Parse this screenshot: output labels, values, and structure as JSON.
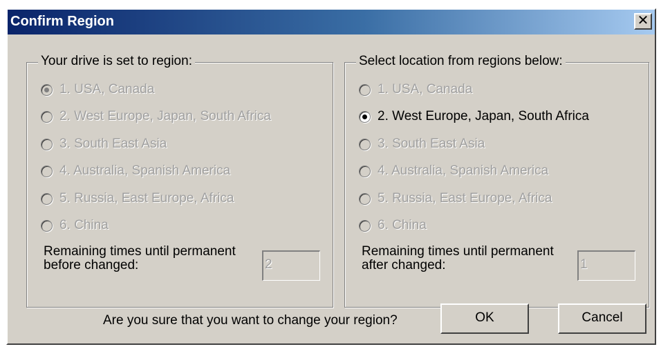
{
  "window": {
    "title": "Confirm Region",
    "close_glyph": "✕"
  },
  "left_group": {
    "title": "Your drive is set to region:",
    "selected_index": 0,
    "options": [
      "1. USA, Canada",
      "2. West Europe, Japan, South Africa",
      "3. South East Asia",
      "4. Australia, Spanish America",
      "5. Russia, East Europe, Africa",
      "6. China"
    ],
    "remaining_label_line1": "Remaining times until permanent",
    "remaining_label_line2": "before changed:",
    "remaining_value": "2"
  },
  "right_group": {
    "title": "Select location from regions below:",
    "selected_index": 1,
    "options": [
      "1. USA, Canada",
      "2. West Europe, Japan, South Africa",
      "3. South East Asia",
      "4. Australia, Spanish America",
      "5. Russia, East Europe, Africa",
      "6. China"
    ],
    "remaining_label_line1": "Remaining times until permanent",
    "remaining_label_line2": "after changed:",
    "remaining_value": "1"
  },
  "footer": {
    "question": "Are you sure that you want to change your region?",
    "ok_label": "OK",
    "cancel_label": "Cancel"
  },
  "colors": {
    "titlebar_start": "#0a246a",
    "titlebar_end": "#a6caf0",
    "face": "#d4d0c8",
    "disabled_text": "#a0a0a0"
  }
}
